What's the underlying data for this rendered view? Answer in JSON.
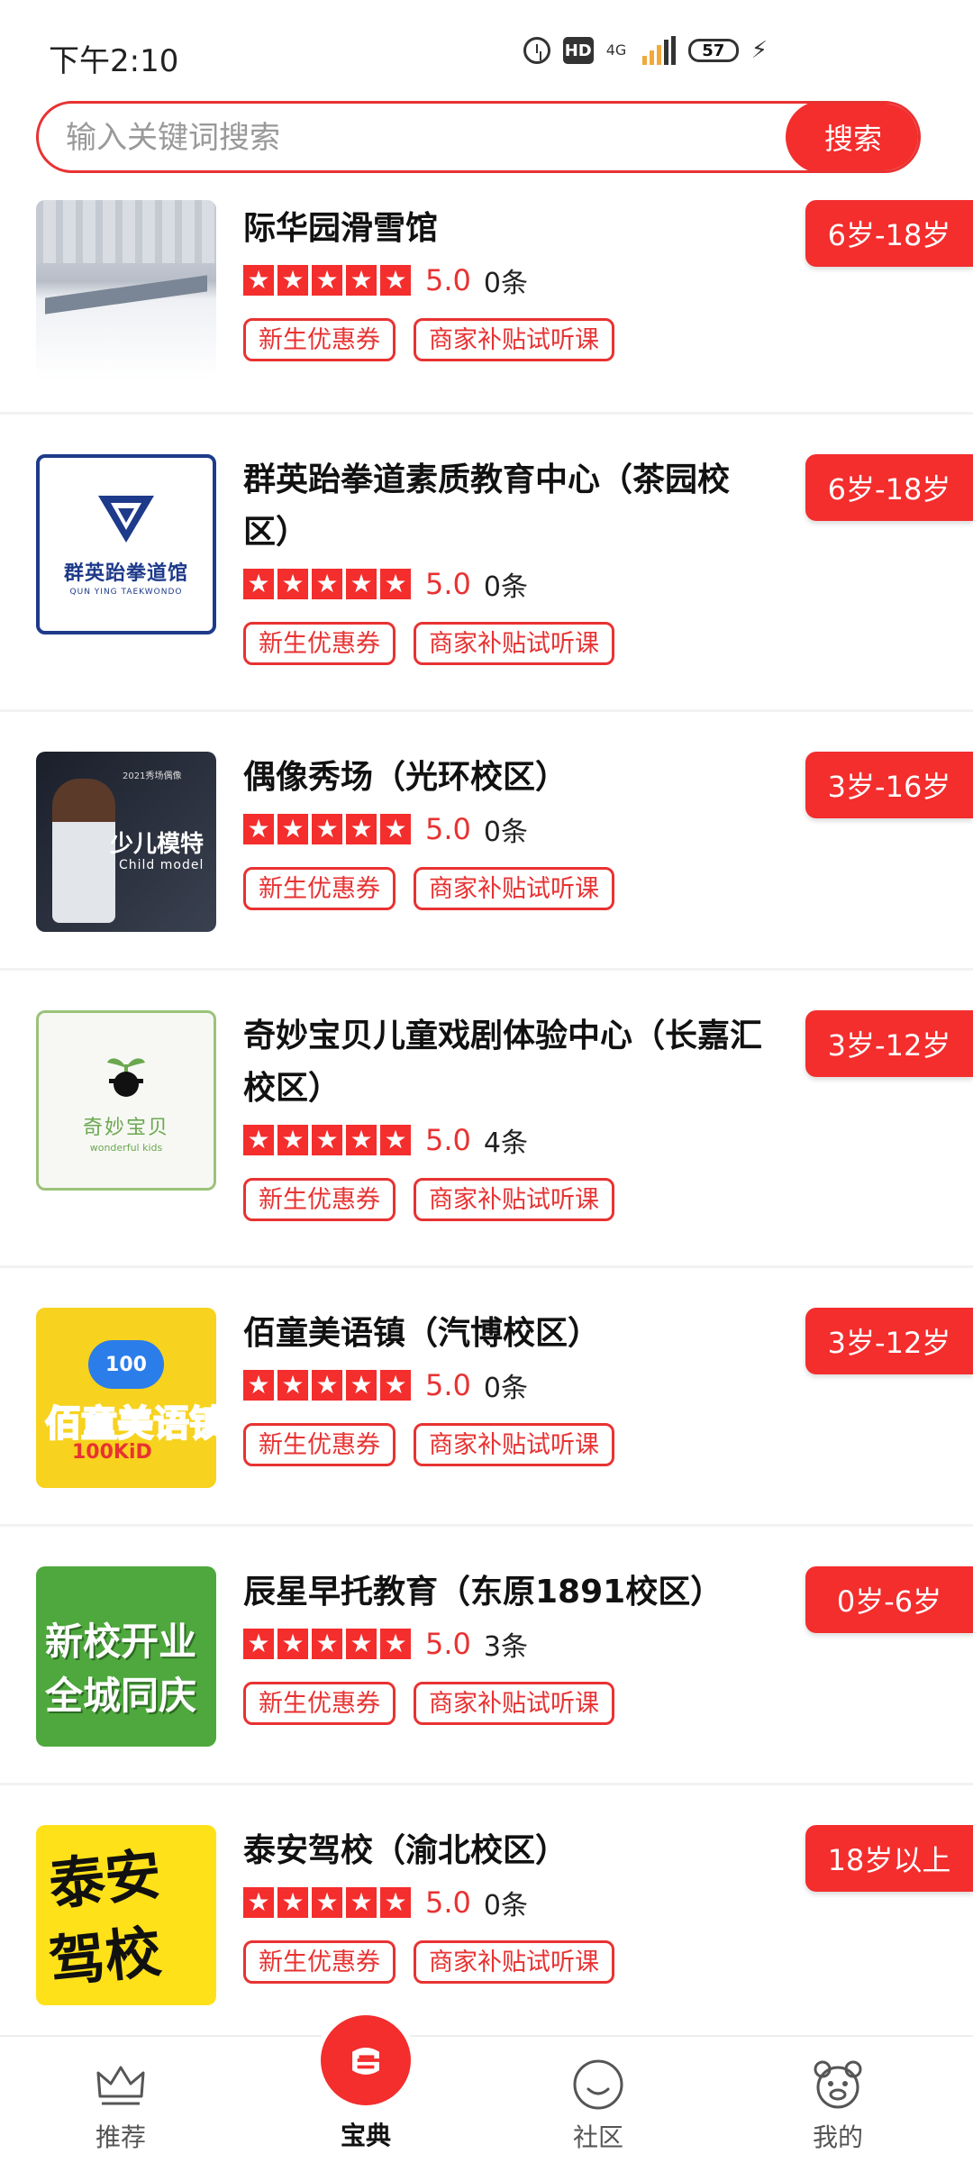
{
  "status_bar": {
    "time": "下午2:10",
    "hd": "HD",
    "network": "4G",
    "battery": "57"
  },
  "search": {
    "placeholder": "输入关键词搜索",
    "button": "搜索"
  },
  "tags": {
    "coupon": "新生优惠券",
    "trial": "商家补贴试听课"
  },
  "items": [
    {
      "name": "际华园滑雪馆",
      "score": "5.0",
      "count": "0条",
      "age": "6岁-18岁"
    },
    {
      "name": "群英跆拳道素质教育中心（茶园校区）",
      "score": "5.0",
      "count": "0条",
      "age": "6岁-18岁",
      "thumb_text": "群英跆拳道馆",
      "thumb_sub": "QUN YING TAEKWONDO"
    },
    {
      "name": "偶像秀场（光环校区）",
      "score": "5.0",
      "count": "0条",
      "age": "3岁-16岁",
      "thumb_top": "2021秀场偶像",
      "thumb_title": "少儿模特",
      "thumb_sub": "Child model"
    },
    {
      "name": "奇妙宝贝儿童戏剧体验中心（长嘉汇校区）",
      "score": "5.0",
      "count": "4条",
      "age": "3岁-12岁",
      "thumb_text": "奇妙宝贝",
      "thumb_sub": "wonderful kids"
    },
    {
      "name": "佰童美语镇（汽博校区）",
      "score": "5.0",
      "count": "0条",
      "age": "3岁-12岁",
      "thumb_text": "佰童美语镇",
      "thumb_sub": "100KiD",
      "thumb_badge": "100"
    },
    {
      "name": "辰星早托教育（东原1891校区）",
      "score": "5.0",
      "count": "3条",
      "age": "0岁-6岁",
      "thumb_line1": "新校开业",
      "thumb_line2": "全城同庆"
    },
    {
      "name": "泰安驾校（渝北校区）",
      "score": "5.0",
      "count": "0条",
      "age": "18岁以上",
      "thumb_line1": "泰安",
      "thumb_line2": "驾校"
    }
  ],
  "nav": [
    {
      "label": "推荐",
      "icon": "crown-icon"
    },
    {
      "label": "宝典",
      "icon": "book-icon",
      "active": true
    },
    {
      "label": "社区",
      "icon": "smile-icon"
    },
    {
      "label": "我的",
      "icon": "bear-icon"
    }
  ],
  "colors": {
    "accent": "#f42d2d",
    "tag_border": "#e83232"
  }
}
